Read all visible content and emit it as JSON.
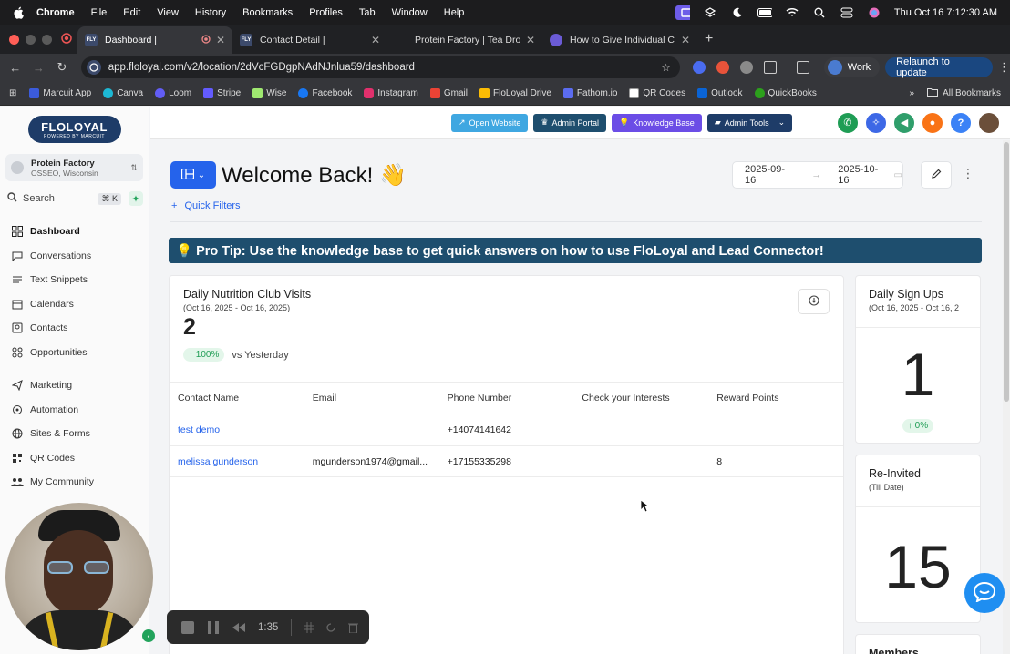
{
  "menubar": {
    "items": [
      "Chrome",
      "File",
      "Edit",
      "View",
      "History",
      "Bookmarks",
      "Profiles",
      "Tab",
      "Window",
      "Help"
    ],
    "clock": "Thu Oct 16  7:12:30 AM"
  },
  "tabs": [
    {
      "label": "Dashboard |",
      "favicon_text": "FLY",
      "favicon_color": "#3c4a6b",
      "active": true
    },
    {
      "label": "Contact Detail |",
      "favicon_text": "FLY",
      "favicon_color": "#3c4a6b",
      "active": false
    },
    {
      "label": "Protein Factory | Tea Drop!!",
      "favicon_text": "",
      "favicon_color": "#202124",
      "active": false
    },
    {
      "label": "How to Give Individual Coupo",
      "favicon_text": "",
      "favicon_color": "#6b5bd6",
      "active": false
    }
  ],
  "address": {
    "url": "app.floloyal.com/v2/location/2dVcFGDgpNAdNJnlua59/dashboard",
    "work_label": "Work",
    "relaunch_label": "Relaunch to update"
  },
  "bookmarks": {
    "items": [
      {
        "label": "Marcuit App",
        "color": "#3b5bdb"
      },
      {
        "label": "Canva",
        "color": "#1db8d4"
      },
      {
        "label": "Loom",
        "color": "#625df5"
      },
      {
        "label": "Stripe",
        "color": "#635bff"
      },
      {
        "label": "Wise",
        "color": "#9fe870"
      },
      {
        "label": "Facebook",
        "color": "#1877f2"
      },
      {
        "label": "Instagram",
        "color": "#e1306c"
      },
      {
        "label": "Gmail",
        "color": "#ea4335"
      },
      {
        "label": "FloLoyal Drive",
        "color": "#fbbc04"
      },
      {
        "label": "Fathom.io",
        "color": "#5b6cf0"
      },
      {
        "label": "QR Codes",
        "color": "#ffffff"
      },
      {
        "label": "Outlook",
        "color": "#0a64d6"
      },
      {
        "label": "QuickBooks",
        "color": "#2ca01c"
      }
    ],
    "all_label": "All Bookmarks"
  },
  "sidebar": {
    "logo_text": "FLOLOYAL",
    "logo_sub": "POWERED BY MARCUIT",
    "location_name": "Protein Factory",
    "location_sub": "OSSEO, Wisconsin",
    "search_label": "Search",
    "search_shortcut": "⌘ K",
    "nav_top": [
      {
        "label": "Dashboard",
        "icon": "dashboard-icon"
      },
      {
        "label": "Conversations",
        "icon": "chat-icon"
      },
      {
        "label": "Text Snippets",
        "icon": "list-icon"
      },
      {
        "label": "Calendars",
        "icon": "calendar-icon"
      },
      {
        "label": "Contacts",
        "icon": "contacts-icon"
      },
      {
        "label": "Opportunities",
        "icon": "opportunities-icon"
      }
    ],
    "nav_bottom": [
      {
        "label": "Marketing",
        "icon": "send-icon"
      },
      {
        "label": "Automation",
        "icon": "automation-icon"
      },
      {
        "label": "Sites & Forms",
        "icon": "sites-icon"
      },
      {
        "label": "QR Codes",
        "icon": "qr-icon"
      },
      {
        "label": "My Community",
        "icon": "community-icon"
      }
    ]
  },
  "topbar": {
    "buttons": [
      {
        "label": "Open Website",
        "color": "#3fa7e1"
      },
      {
        "label": "Admin Portal",
        "color": "#1e4e6e"
      },
      {
        "label": "Knowledge Base",
        "color": "#6b4de6"
      },
      {
        "label": "Admin Tools",
        "color": "#1e3c68"
      }
    ]
  },
  "dashboard": {
    "welcome": "Welcome Back! 👋",
    "date_start": "2025-09-16",
    "date_end": "2025-10-16",
    "quick_filters": "Quick Filters",
    "protip": "💡 Pro Tip: Use the knowledge base to get quick answers on how to use FloLoyal and Lead Connector!",
    "visits": {
      "title": "Daily Nutrition Club Visits",
      "range": "(Oct 16, 2025 - Oct 16, 2025)",
      "value": "2",
      "trend": "↑ 100%",
      "trend_text": "vs Yesterday",
      "columns": [
        "Contact Name",
        "Email",
        "Phone Number",
        "Check your Interests",
        "Reward Points"
      ],
      "rows": [
        [
          "test demo",
          "",
          "+14074141642",
          "",
          ""
        ],
        [
          "melissa gunderson",
          "mgunderson1974@gmail...",
          "+17155335298",
          "",
          "8"
        ]
      ]
    },
    "signups": {
      "title": "Daily Sign Ups",
      "range": "(Oct 16, 2025 - Oct 16, 2",
      "value": "1",
      "trend": "↑ 0%"
    },
    "reinvited": {
      "title": "Re-Invited",
      "range": "(Till Date)",
      "value": "15"
    },
    "members": {
      "title": "Members"
    }
  },
  "recorder": {
    "time": "1:35"
  }
}
